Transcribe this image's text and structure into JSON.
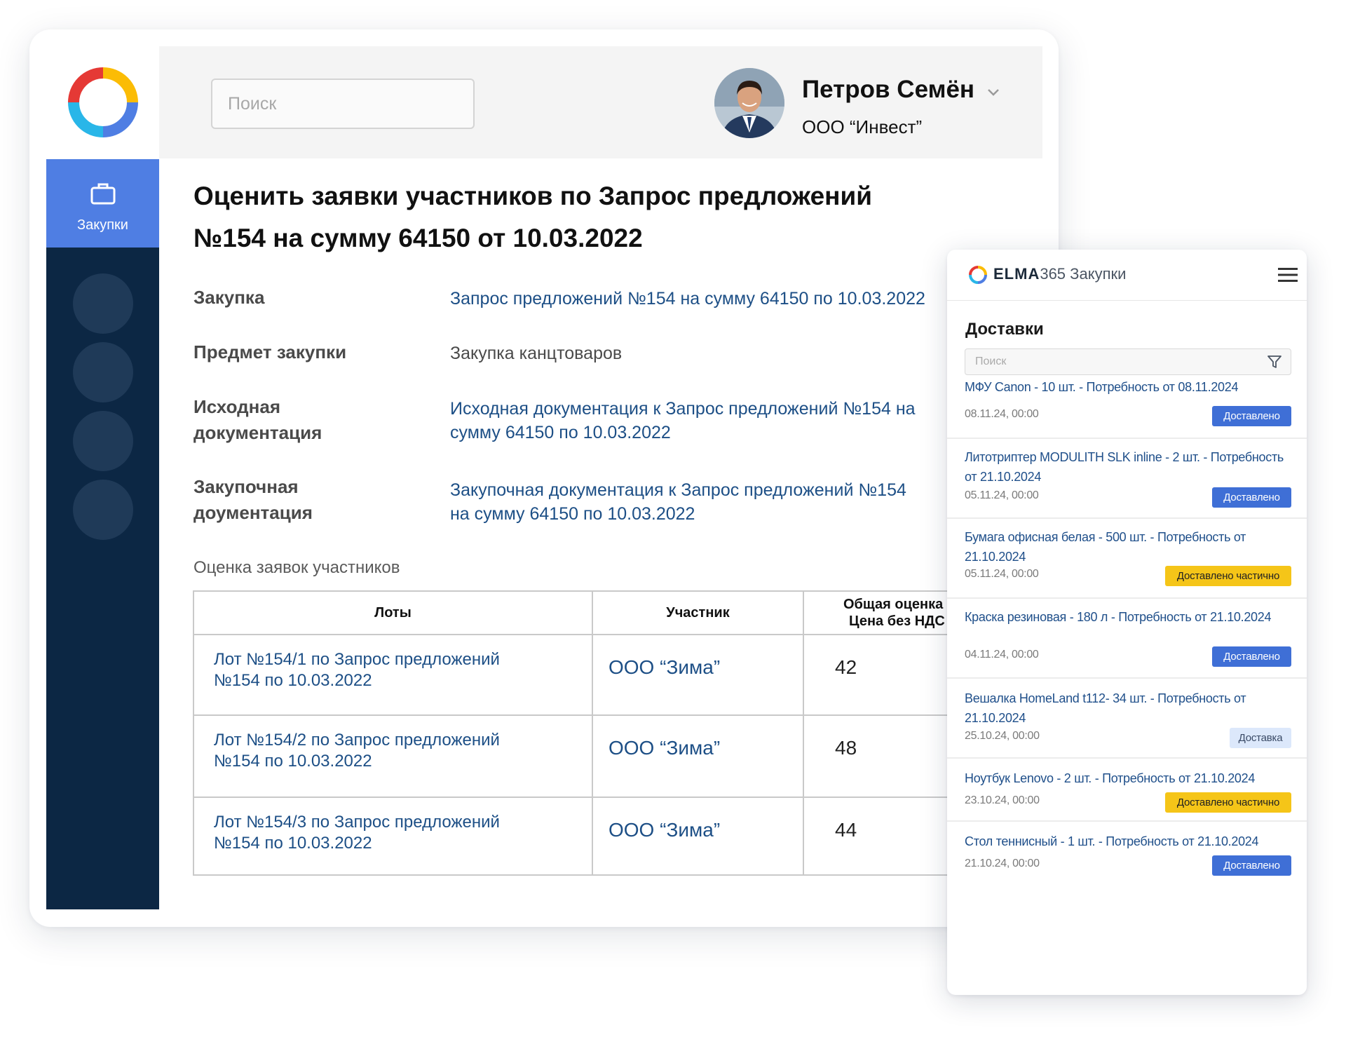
{
  "search": {
    "placeholder": "Поиск"
  },
  "sidebar": {
    "active_label": "Закупки"
  },
  "user": {
    "name": "Петров Семён",
    "org": "ООО “Инвест”"
  },
  "page": {
    "title_line1": "Оценить заявки участников по Запрос предложений",
    "title_line2": "№154 на сумму 64150 от 10.03.2022"
  },
  "fields": [
    {
      "label1": "Закупка",
      "label2": "",
      "value1": "Запрос предложений №154 на сумму 64150 по 10.03.2022",
      "value2": ""
    },
    {
      "label1": "Предмет закупки",
      "label2": "",
      "value1": "Закупка канцтоваров",
      "value2": ""
    },
    {
      "label1": "Исходная",
      "label2": "документация",
      "value1": "Исходная документация к Запрос предложений №154 на",
      "value2": "сумму 64150 по 10.03.2022"
    },
    {
      "label1": "Закупочная",
      "label2": "доументация",
      "value1": "Закупочная документация к Запрос предложений №154",
      "value2": "на сумму 64150 по 10.03.2022"
    }
  ],
  "evaluation": {
    "section_label": "Оценка заявок участников",
    "headers": {
      "lots": "Лоты",
      "participant": "Участник",
      "score_line1": "Общая оценка",
      "score_line2": "Цена без НДС"
    },
    "rows": [
      {
        "lot_line1": "Лот №154/1 по Запрос предложений",
        "lot_line2": "№154 по 10.03.2022",
        "participant": "ООО “Зима”",
        "score": "42"
      },
      {
        "lot_line1": "Лот №154/2 по Запрос предложений",
        "lot_line2": "№154 по 10.03.2022",
        "participant": "ООО “Зима”",
        "score": "48"
      },
      {
        "lot_line1": "Лот №154/3 по Запрос предложений",
        "lot_line2": "№154 по 10.03.2022",
        "participant": "ООО “Зима”",
        "score": "44"
      }
    ]
  },
  "mobile": {
    "brand_bold": "ELMA",
    "brand_num": "365",
    "brand_suffix": "Закупки",
    "title": "Доставки",
    "search_placeholder": "Поиск",
    "items": [
      {
        "title": "МФУ Canon - 10 шт. - Потребность от 08.11.2024",
        "date": "08.11.24, 00:00",
        "status": "Доставлено"
      },
      {
        "title": "Литотриптер MODULITH SLK inline - 2 шт. - Потребность от 21.10.2024",
        "date": "05.11.24, 00:00",
        "status": "Доставлено"
      },
      {
        "title": "Бумага офисная белая - 500 шт. - Потребность от 21.10.2024",
        "date": "05.11.24, 00:00",
        "status": "Доставлено частично"
      },
      {
        "title": "Краска резиновая - 180 л - Потребность от 21.10.2024",
        "date": "04.11.24, 00:00",
        "status": "Доставлено"
      },
      {
        "title": "Вешалка HomeLand t112- 34 шт. - Потребность от 21.10.2024",
        "date": "25.10.24, 00:00",
        "status": "Доставка"
      },
      {
        "title": "Ноутбук Lenovo - 2 шт. - Потребность от 21.10.2024",
        "date": "23.10.24, 00:00",
        "status": "Доставлено частично"
      },
      {
        "title": "Стол теннисный - 1 шт. - Потребность от 21.10.2024",
        "date": "21.10.24, 00:00",
        "status": "Доставлено"
      }
    ]
  },
  "colors": {
    "sidebar": "#0c2744",
    "accent": "#4f7ee3",
    "link": "#1d4f86",
    "badge_blue": "#3f6fd6",
    "badge_yellow": "#f5c518",
    "badge_light": "#dce8fb"
  }
}
